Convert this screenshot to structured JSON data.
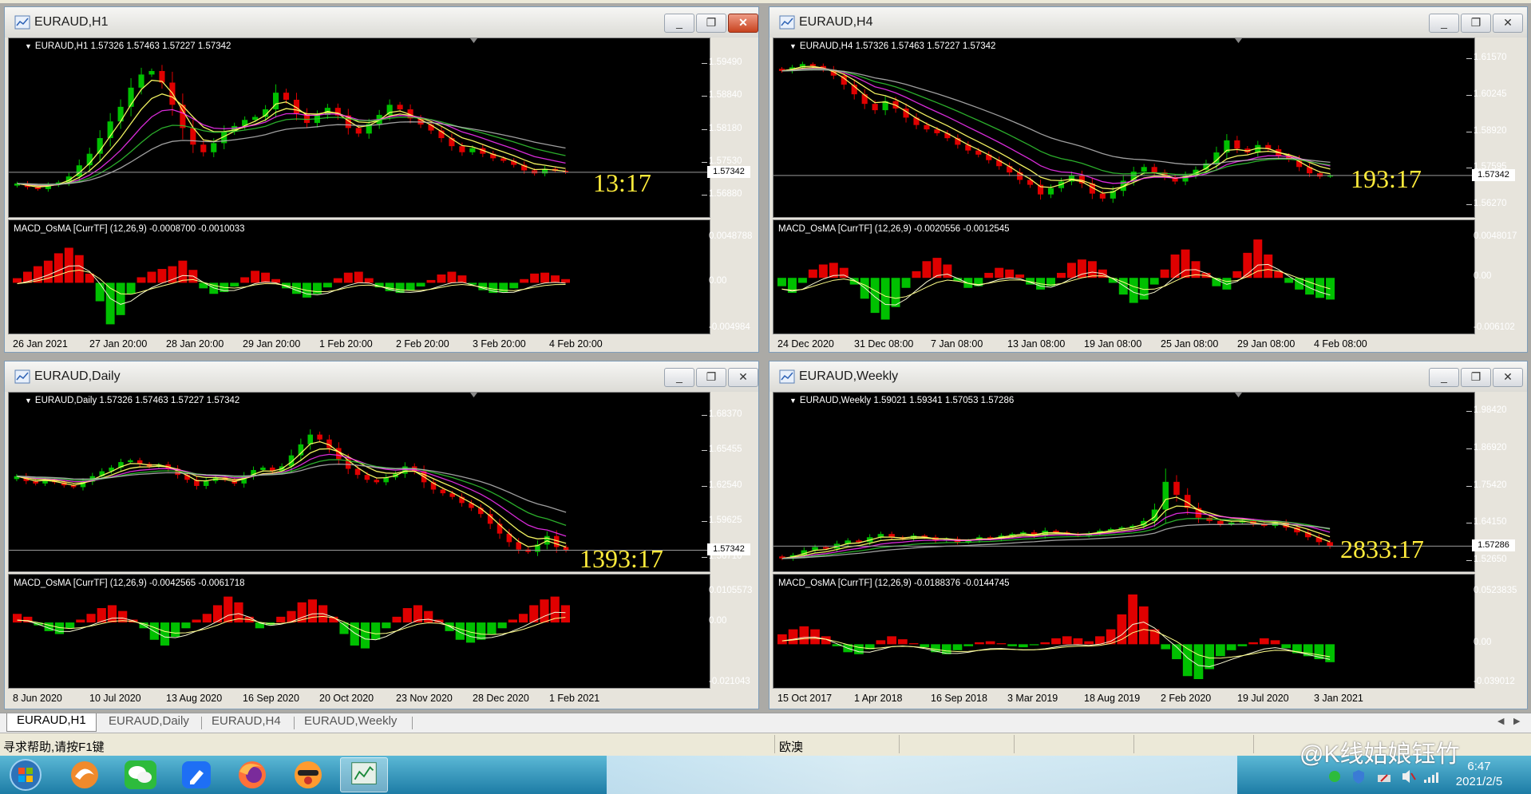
{
  "windows": [
    {
      "title": "EURAUD,H1",
      "info": "EURAUD,H1  1.57326 1.57463 1.57227 1.57342",
      "price_scale": [
        "1.59490",
        "1.58840",
        "1.58180",
        "1.57530",
        "1.56880"
      ],
      "current_price": "1.57342",
      "timer": "13:17",
      "macd_label": "MACD_OsMA [CurrTF] (12,26,9) -0.0008700 -0.0010033",
      "macd_scale": [
        "0.0048788",
        "0.00",
        "-0.004984"
      ],
      "time_labels": [
        "26 Jan 2021",
        "27 Jan 20:00",
        "28 Jan 20:00",
        "29 Jan 20:00",
        "1 Feb 20:00",
        "2 Feb 20:00",
        "3 Feb 20:00",
        "4 Feb 20:00"
      ]
    },
    {
      "title": "EURAUD,H4",
      "info": "EURAUD,H4  1.57326 1.57463 1.57227 1.57342",
      "price_scale": [
        "1.61570",
        "1.60245",
        "1.58920",
        "1.57595",
        "1.56270"
      ],
      "current_price": "1.57342",
      "timer": "193:17",
      "macd_label": "MACD_OsMA [CurrTF] (12,26,9) -0.0020556 -0.0012545",
      "macd_scale": [
        "0.0048017",
        "0.00",
        "-0.006102"
      ],
      "time_labels": [
        "24 Dec 2020",
        "31 Dec 08:00",
        "7 Jan 08:00",
        "13 Jan 08:00",
        "19 Jan 08:00",
        "25 Jan 08:00",
        "29 Jan 08:00",
        "4 Feb 08:00"
      ]
    },
    {
      "title": "EURAUD,Daily",
      "info": "EURAUD,Daily  1.57326 1.57463 1.57227 1.57342",
      "price_scale": [
        "1.68370",
        "1.65455",
        "1.62540",
        "1.59625",
        "1.56710"
      ],
      "current_price": "1.57342",
      "timer": "1393:17",
      "macd_label": "MACD_OsMA [CurrTF] (12,26,9) -0.0042565 -0.0061718",
      "macd_scale": [
        "0.0105573",
        "0.00",
        "-0.021043"
      ],
      "time_labels": [
        "8 Jun 2020",
        "10 Jul 2020",
        "13 Aug 2020",
        "16 Sep 2020",
        "20 Oct 2020",
        "23 Nov 2020",
        "28 Dec 2020",
        "1 Feb 2021"
      ]
    },
    {
      "title": "EURAUD,Weekly",
      "info": "EURAUD,Weekly  1.59021 1.59341 1.57053 1.57286",
      "price_scale": [
        "1.98420",
        "1.86920",
        "1.75420",
        "1.64150",
        "1.52650"
      ],
      "current_price": "1.57286",
      "timer": "2833:17",
      "macd_label": "MACD_OsMA [CurrTF] (12,26,9) -0.0188376 -0.0144745",
      "macd_scale": [
        "0.0523835",
        "0.00",
        "-0.039012"
      ],
      "time_labels": [
        "15 Oct 2017",
        "1 Apr 2018",
        "16 Sep 2018",
        "3 Mar 2019",
        "18 Aug 2019",
        "2 Feb 2020",
        "19 Jul 2020",
        "3 Jan 2021"
      ]
    }
  ],
  "tabs": [
    "EURAUD,H1",
    "EURAUD,Daily",
    "EURAUD,H4",
    "EURAUD,Weekly"
  ],
  "status": {
    "help": "寻求帮助,请按F1键",
    "group": "欧澳"
  },
  "taskbar": {
    "apps": [
      "windows-start",
      "browser-orange",
      "wechat",
      "feishu-docs",
      "firefox",
      "avatar-app",
      "metatrader"
    ],
    "time": "6:47",
    "date": "2021/2/5"
  },
  "watermark": "@K线姑娘钰竹",
  "colors": {
    "bull": "#00c000",
    "bear": "#e00000",
    "ma_yellow": "#ffff66",
    "ma_magenta": "#ff33ff",
    "ma_green": "#33cc33",
    "ma_gray": "#bbbbbb",
    "timer": "#ffeb3b"
  },
  "chart_data": [
    {
      "type": "candlestick",
      "symbol": "EURAUD",
      "timeframe": "H1",
      "ylim": [
        1.5655,
        1.5965
      ],
      "yticks": [
        1.5949,
        1.5884,
        1.5818,
        1.5753,
        1.5688
      ],
      "last": 1.57342,
      "closes": [
        1.5712,
        1.5705,
        1.5701,
        1.5709,
        1.5714,
        1.5726,
        1.5748,
        1.5771,
        1.5802,
        1.5835,
        1.5864,
        1.5902,
        1.5928,
        1.5935,
        1.5912,
        1.5868,
        1.5822,
        1.5789,
        1.5774,
        1.5792,
        1.5815,
        1.5826,
        1.5838,
        1.5844,
        1.5859,
        1.5892,
        1.5878,
        1.5851,
        1.5832,
        1.5848,
        1.5862,
        1.5847,
        1.5822,
        1.5811,
        1.583,
        1.5848,
        1.5868,
        1.5859,
        1.5841,
        1.5829,
        1.5817,
        1.5802,
        1.5786,
        1.5774,
        1.5782,
        1.5771,
        1.5762,
        1.5757,
        1.5749,
        1.5738,
        1.5732,
        1.5741,
        1.5737,
        1.5734
      ],
      "macd_hist": [
        0.0005,
        0.0012,
        0.0018,
        0.0024,
        0.0032,
        0.0038,
        0.003,
        0.001,
        -0.002,
        -0.0045,
        -0.0035,
        -0.0012,
        0.0006,
        0.0012,
        0.0015,
        0.0018,
        0.0024,
        0.0014,
        -0.0006,
        -0.0012,
        -0.001,
        -0.0004,
        0.0006,
        0.0013,
        0.0011,
        0.0004,
        -0.0006,
        -0.0012,
        -0.0016,
        -0.0012,
        -0.0005,
        0.0005,
        0.0011,
        0.0012,
        0.0005,
        -0.0005,
        -0.0009,
        -0.0011,
        -0.0008,
        -0.0004,
        0.0003,
        0.0009,
        0.0012,
        0.0008,
        -0.0002,
        -0.0008,
        -0.0011,
        -0.001,
        -0.0006,
        0.0004,
        0.001,
        0.0011,
        0.0008,
        0.0004
      ],
      "ylim_macd": [
        -0.004984,
        0.0048788
      ]
    },
    {
      "type": "candlestick",
      "symbol": "EURAUD",
      "timeframe": "H4",
      "ylim": [
        1.56,
        1.617
      ],
      "yticks": [
        1.6157,
        1.60245,
        1.5892,
        1.57595,
        1.5627
      ],
      "last": 1.57342,
      "closes": [
        1.6115,
        1.6128,
        1.614,
        1.6133,
        1.612,
        1.6098,
        1.6065,
        1.603,
        1.5995,
        1.5972,
        1.6005,
        1.5978,
        1.5945,
        1.5918,
        1.5902,
        1.5888,
        1.587,
        1.5846,
        1.5825,
        1.581,
        1.579,
        1.5768,
        1.5745,
        1.5718,
        1.57,
        1.5665,
        1.5688,
        1.5712,
        1.5735,
        1.5705,
        1.5668,
        1.565,
        1.5678,
        1.5715,
        1.5748,
        1.5765,
        1.5745,
        1.5728,
        1.5712,
        1.5735,
        1.5755,
        1.5778,
        1.5818,
        1.5862,
        1.5832,
        1.5818,
        1.5845,
        1.583,
        1.5806,
        1.5792,
        1.5765,
        1.5742,
        1.573,
        1.5734
      ],
      "macd_hist": [
        -0.001,
        -0.0018,
        -0.0006,
        0.001,
        0.0016,
        0.0018,
        0.0012,
        -0.0008,
        -0.0025,
        -0.0042,
        -0.005,
        -0.0035,
        -0.0012,
        0.0008,
        0.002,
        0.0024,
        0.0016,
        -0.0004,
        -0.0012,
        -0.001,
        0.0006,
        0.0012,
        0.001,
        0.0004,
        -0.0008,
        -0.0014,
        -0.001,
        0.0006,
        0.0018,
        0.0022,
        0.002,
        0.001,
        -0.0006,
        -0.002,
        -0.003,
        -0.0026,
        -0.0008,
        0.001,
        0.0028,
        0.0034,
        0.002,
        0.0006,
        -0.001,
        -0.0014,
        0.0008,
        0.003,
        0.0046,
        0.0028,
        0.0008,
        -0.0006,
        -0.0014,
        -0.002,
        -0.0024,
        -0.0026
      ],
      "ylim_macd": [
        -0.006102,
        0.0048017
      ]
    },
    {
      "type": "candlestick",
      "symbol": "EURAUD",
      "timeframe": "Daily",
      "ylim": [
        1.56,
        1.688
      ],
      "yticks": [
        1.6837,
        1.65455,
        1.6254,
        1.59625,
        1.5671
      ],
      "last": 1.57342,
      "closes": [
        1.634,
        1.63,
        1.628,
        1.631,
        1.629,
        1.6265,
        1.625,
        1.6295,
        1.634,
        1.638,
        1.641,
        1.6455,
        1.647,
        1.644,
        1.642,
        1.6435,
        1.64,
        1.635,
        1.631,
        1.626,
        1.63,
        1.633,
        1.631,
        1.628,
        1.634,
        1.639,
        1.641,
        1.638,
        1.642,
        1.651,
        1.66,
        1.668,
        1.664,
        1.657,
        1.648,
        1.64,
        1.635,
        1.631,
        1.629,
        1.633,
        1.636,
        1.642,
        1.638,
        1.629,
        1.623,
        1.62,
        1.617,
        1.612,
        1.608,
        1.603,
        1.595,
        1.587,
        1.58,
        1.574,
        1.572,
        1.578,
        1.585,
        1.576,
        1.5734
      ],
      "macd_hist": [
        0.003,
        0.002,
        -0.001,
        -0.003,
        -0.004,
        -0.002,
        0.001,
        0.003,
        0.005,
        0.006,
        0.004,
        0.001,
        -0.002,
        -0.006,
        -0.008,
        -0.005,
        -0.002,
        0.001,
        0.003,
        0.006,
        0.009,
        0.007,
        0.002,
        -0.002,
        -0.001,
        0.002,
        0.004,
        0.007,
        0.008,
        0.006,
        0.002,
        -0.004,
        -0.008,
        -0.009,
        -0.006,
        -0.002,
        0.002,
        0.005,
        0.006,
        0.004,
        0.001,
        -0.003,
        -0.006,
        -0.007,
        -0.006,
        -0.004,
        -0.002,
        0.001,
        0.003,
        0.006,
        0.008,
        0.009,
        0.006
      ],
      "ylim_macd": [
        -0.021043,
        0.0105573
      ]
    },
    {
      "type": "candlestick",
      "symbol": "EURAUD",
      "timeframe": "Weekly",
      "ylim": [
        1.51,
        1.99
      ],
      "yticks": [
        1.9842,
        1.8692,
        1.7542,
        1.6415,
        1.5265
      ],
      "last": 1.57286,
      "closes": [
        1.535,
        1.545,
        1.56,
        1.57,
        1.565,
        1.58,
        1.59,
        1.585,
        1.6,
        1.61,
        1.6,
        1.595,
        1.605,
        1.6,
        1.59,
        1.595,
        1.585,
        1.59,
        1.6,
        1.595,
        1.605,
        1.61,
        1.615,
        1.605,
        1.62,
        1.615,
        1.61,
        1.605,
        1.612,
        1.62,
        1.625,
        1.63,
        1.635,
        1.65,
        1.685,
        1.77,
        1.73,
        1.69,
        1.66,
        1.65,
        1.64,
        1.645,
        1.65,
        1.64,
        1.635,
        1.645,
        1.63,
        1.615,
        1.6,
        1.585,
        1.5729
      ],
      "macd_hist": [
        0.01,
        0.015,
        0.018,
        0.015,
        0.008,
        -0.002,
        -0.008,
        -0.01,
        -0.005,
        0.004,
        0.008,
        0.005,
        0.001,
        -0.003,
        -0.008,
        -0.01,
        -0.006,
        -0.002,
        0.002,
        0.003,
        0.001,
        -0.002,
        -0.003,
        -0.001,
        0.002,
        0.006,
        0.008,
        0.006,
        0.003,
        0.008,
        0.015,
        0.03,
        0.05,
        0.038,
        0.015,
        -0.005,
        -0.015,
        -0.032,
        -0.035,
        -0.025,
        -0.012,
        -0.006,
        -0.002,
        0.002,
        0.006,
        0.004,
        -0.004,
        -0.009,
        -0.012,
        -0.015,
        -0.018
      ],
      "ylim_macd": [
        -0.039012,
        0.0523835
      ]
    }
  ]
}
